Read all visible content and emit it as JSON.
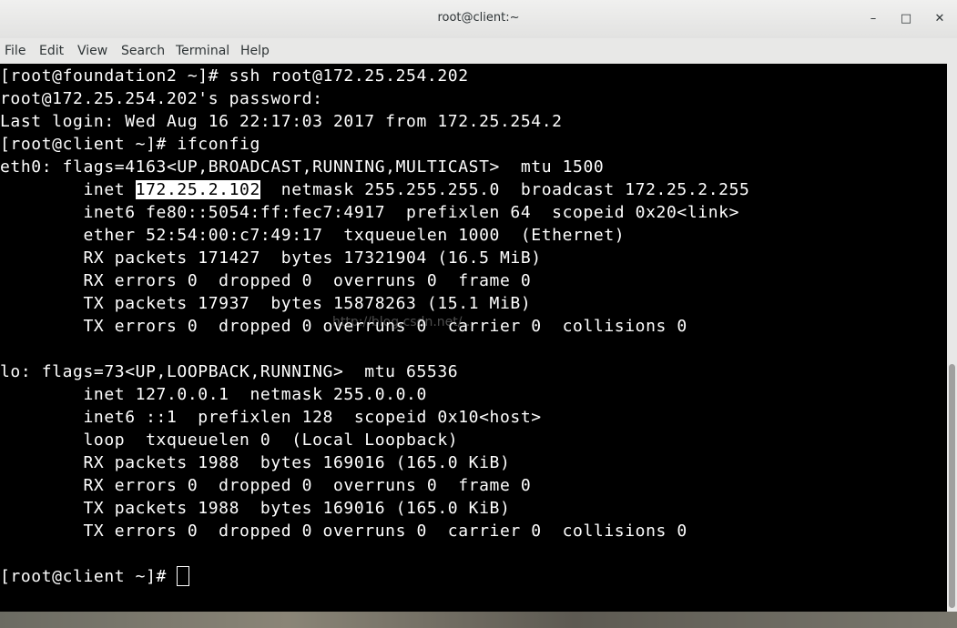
{
  "window": {
    "title": "root@client:~",
    "controls": {
      "minimize": "–",
      "maximize": "□",
      "close": "✕"
    }
  },
  "menu": [
    "File",
    "Edit",
    "View",
    "Search",
    "Terminal",
    "Help"
  ],
  "terminal": {
    "lines": [
      "[root@foundation2 ~]# ssh root@172.25.254.202",
      "root@172.25.254.202's password:",
      "Last login: Wed Aug 16 22:17:03 2017 from 172.25.254.2",
      "[root@client ~]# ifconfig",
      "eth0: flags=4163<UP,BROADCAST,RUNNING,MULTICAST>  mtu 1500",
      "",
      "        inet6 fe80::5054:ff:fec7:4917  prefixlen 64  scopeid 0x20<link>",
      "        ether 52:54:00:c7:49:17  txqueuelen 1000  (Ethernet)",
      "        RX packets 171427  bytes 17321904 (16.5 MiB)",
      "        RX errors 0  dropped 0  overruns 0  frame 0",
      "        TX packets 17937  bytes 15878263 (15.1 MiB)",
      "        TX errors 0  dropped 0 overruns 0  carrier 0  collisions 0",
      "",
      "lo: flags=73<UP,LOOPBACK,RUNNING>  mtu 65536",
      "        inet 127.0.0.1  netmask 255.0.0.0",
      "        inet6 ::1  prefixlen 128  scopeid 0x10<host>",
      "        loop  txqueuelen 0  (Local Loopback)",
      "        RX packets 1988  bytes 169016 (165.0 KiB)",
      "        RX errors 0  dropped 0  overruns 0  frame 0",
      "        TX packets 1988  bytes 169016 (165.0 KiB)",
      "        TX errors 0  dropped 0 overruns 0  carrier 0  collisions 0",
      "",
      "[root@client ~]# "
    ],
    "inet_line": {
      "prefix": "        inet ",
      "selected": "172.25.2.102",
      "suffix": "  netmask 255.255.255.0  broadcast 172.25.2.255"
    },
    "watermark": "http://blog.csdn.net/...",
    "colors": {
      "background": "#000000",
      "foreground": "#ffffff"
    }
  }
}
